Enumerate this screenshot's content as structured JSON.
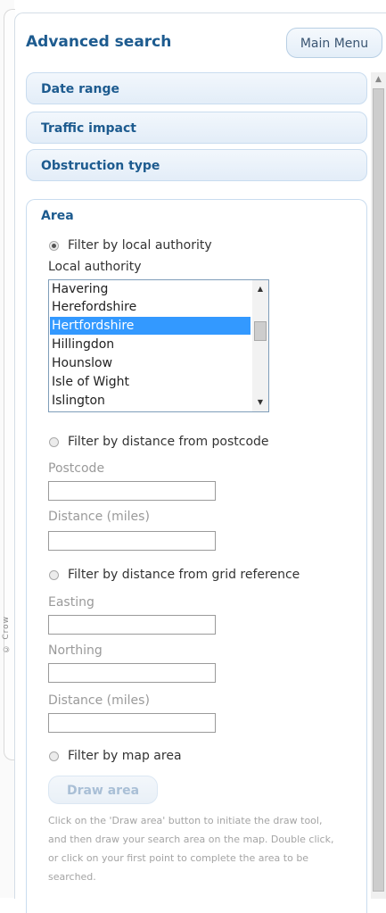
{
  "header": {
    "title": "Advanced search",
    "main_menu_label": "Main Menu"
  },
  "sections": {
    "date_range": "Date range",
    "traffic_impact": "Traffic impact",
    "obstruction_type": "Obstruction type",
    "area": "Area"
  },
  "area": {
    "filter_local_authority": {
      "label": "Filter by local authority",
      "checked": true
    },
    "local_authority_label": "Local authority",
    "local_authorities": [
      "Havering",
      "Herefordshire",
      "Hertfordshire",
      "Hillingdon",
      "Hounslow",
      "Isle of Wight",
      "Islington"
    ],
    "selected_authority": "Hertfordshire",
    "filter_postcode": {
      "label": "Filter by distance from postcode",
      "checked": false
    },
    "postcode_label": "Postcode",
    "postcode_value": "",
    "postcode_distance_label": "Distance (miles)",
    "postcode_distance_value": "",
    "filter_grid": {
      "label": "Filter by distance from grid reference",
      "checked": false
    },
    "easting_label": "Easting",
    "easting_value": "",
    "northing_label": "Northing",
    "northing_value": "",
    "grid_distance_label": "Distance (miles)",
    "grid_distance_value": "",
    "filter_map": {
      "label": "Filter by map area",
      "checked": false
    },
    "draw_area_label": "Draw area",
    "help_text": "Click on the 'Draw area' button to initiate the draw tool, and then draw your search area on the map. Double click, or click on your first point to complete the area to be searched."
  },
  "background_map_text": "© Crow",
  "colors": {
    "accent": "#1d5b8f",
    "selection": "#3399ff",
    "border": "#c9dcef"
  },
  "icons": {
    "scroll_up": "triangle-up",
    "scroll_down": "triangle-down",
    "radio_checked": "radio-filled",
    "radio_unchecked": "radio-empty"
  }
}
